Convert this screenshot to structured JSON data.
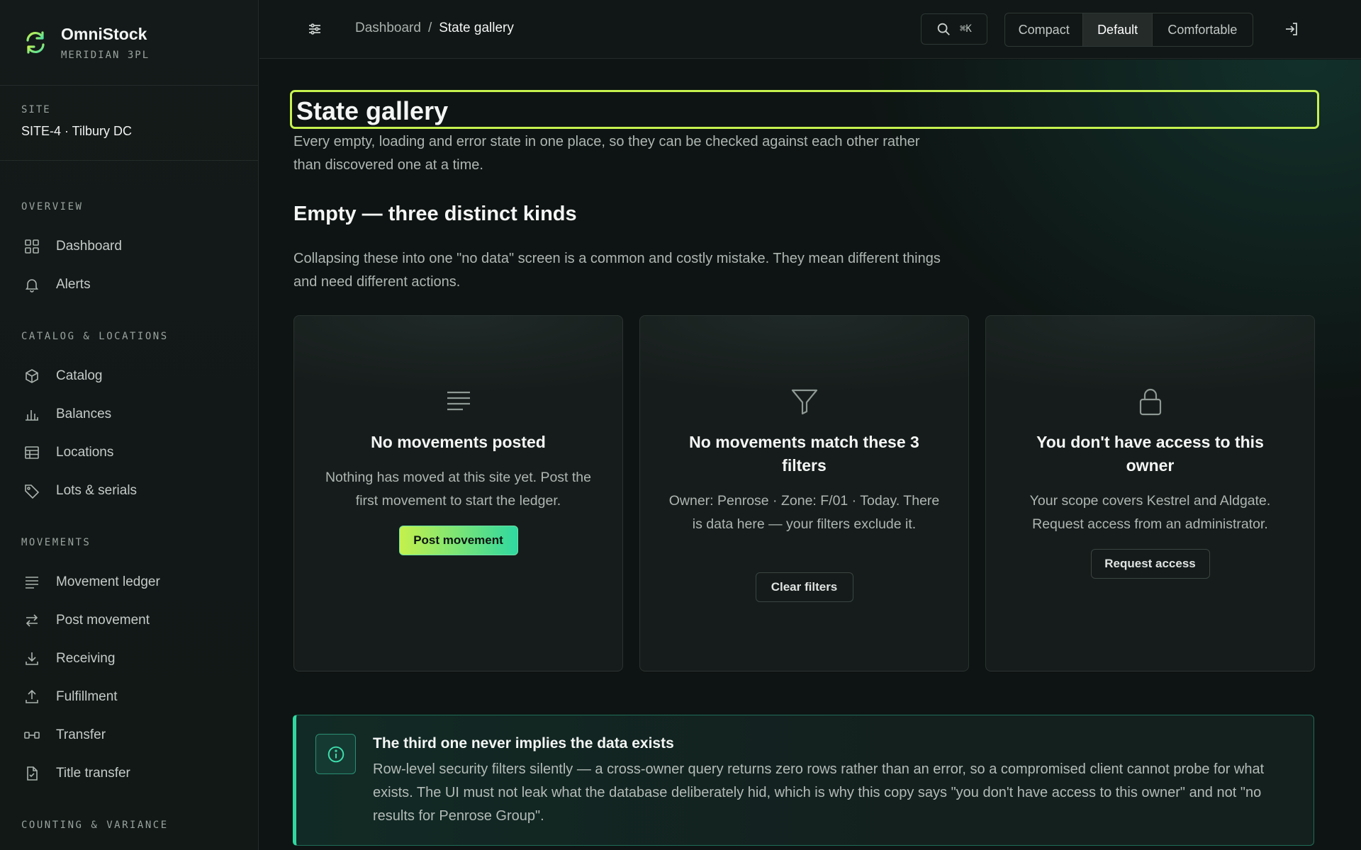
{
  "brand": {
    "name": "OmniStock",
    "subtitle": "MERIDIAN 3PL"
  },
  "site": {
    "label": "SITE",
    "name": "SITE-4 · Tilbury DC"
  },
  "nav": {
    "overview": {
      "title": "OVERVIEW",
      "items": [
        {
          "label": "Dashboard",
          "icon": "grid-icon"
        },
        {
          "label": "Alerts",
          "icon": "bell-icon"
        }
      ]
    },
    "catalog": {
      "title": "CATALOG & LOCATIONS",
      "items": [
        {
          "label": "Catalog",
          "icon": "box-icon"
        },
        {
          "label": "Balances",
          "icon": "bar-chart-icon"
        },
        {
          "label": "Locations",
          "icon": "table-icon"
        },
        {
          "label": "Lots & serials",
          "icon": "tag-icon"
        }
      ]
    },
    "movements": {
      "title": "MOVEMENTS",
      "items": [
        {
          "label": "Movement ledger",
          "icon": "lines-icon"
        },
        {
          "label": "Post movement",
          "icon": "arrows-swap-icon"
        },
        {
          "label": "Receiving",
          "icon": "download-icon"
        },
        {
          "label": "Fulfillment",
          "icon": "upload-icon"
        },
        {
          "label": "Transfer",
          "icon": "transfer-icon"
        },
        {
          "label": "Title transfer",
          "icon": "document-icon"
        }
      ]
    },
    "counting": {
      "title": "COUNTING & VARIANCE"
    }
  },
  "topbar": {
    "breadcrumb": {
      "root": "Dashboard",
      "separator": "/",
      "current": "State gallery"
    },
    "search_shortcut": "⌘K",
    "density": {
      "compact": "Compact",
      "default": "Default",
      "comfortable": "Comfortable",
      "selected": "Default"
    }
  },
  "page": {
    "title": "State gallery",
    "intro": "Every empty, loading and error state in one place, so they can be checked against each other rather than discovered one at a time.",
    "section_title": "Empty — three distinct kinds",
    "section_desc": "Collapsing these into one \"no data\" screen is a common and costly mistake. They mean different things and need different actions."
  },
  "cards": [
    {
      "icon": "lines-icon",
      "title": "No movements posted",
      "body": "Nothing has moved at this site yet. Post the first movement to start the ledger.",
      "action": "Post movement"
    },
    {
      "icon": "filter-icon",
      "title": "No movements match these 3 filters",
      "body": "Owner: Penrose · Zone: F/01 · Today. There is data here — your filters exclude it.",
      "action": "Clear filters"
    },
    {
      "icon": "lock-icon",
      "title": "You don't have access to this owner",
      "body": "Your scope covers Kestrel and Aldgate. Request access from an administrator.",
      "action": "Request access"
    }
  ],
  "callout": {
    "title": "The third one never implies the data exists",
    "body": "Row-level security filters silently — a cross-owner query returns zero rows rather than an error, so a compromised client cannot probe for what exists. The UI must not leak what the database deliberately hid, which is why this copy says \"you don't have access to this owner\" and not \"no results for Penrose Group\"."
  },
  "colors": {
    "accent": "#c6f24f",
    "accent2": "#2fd8a0",
    "background": "#0e1413"
  }
}
